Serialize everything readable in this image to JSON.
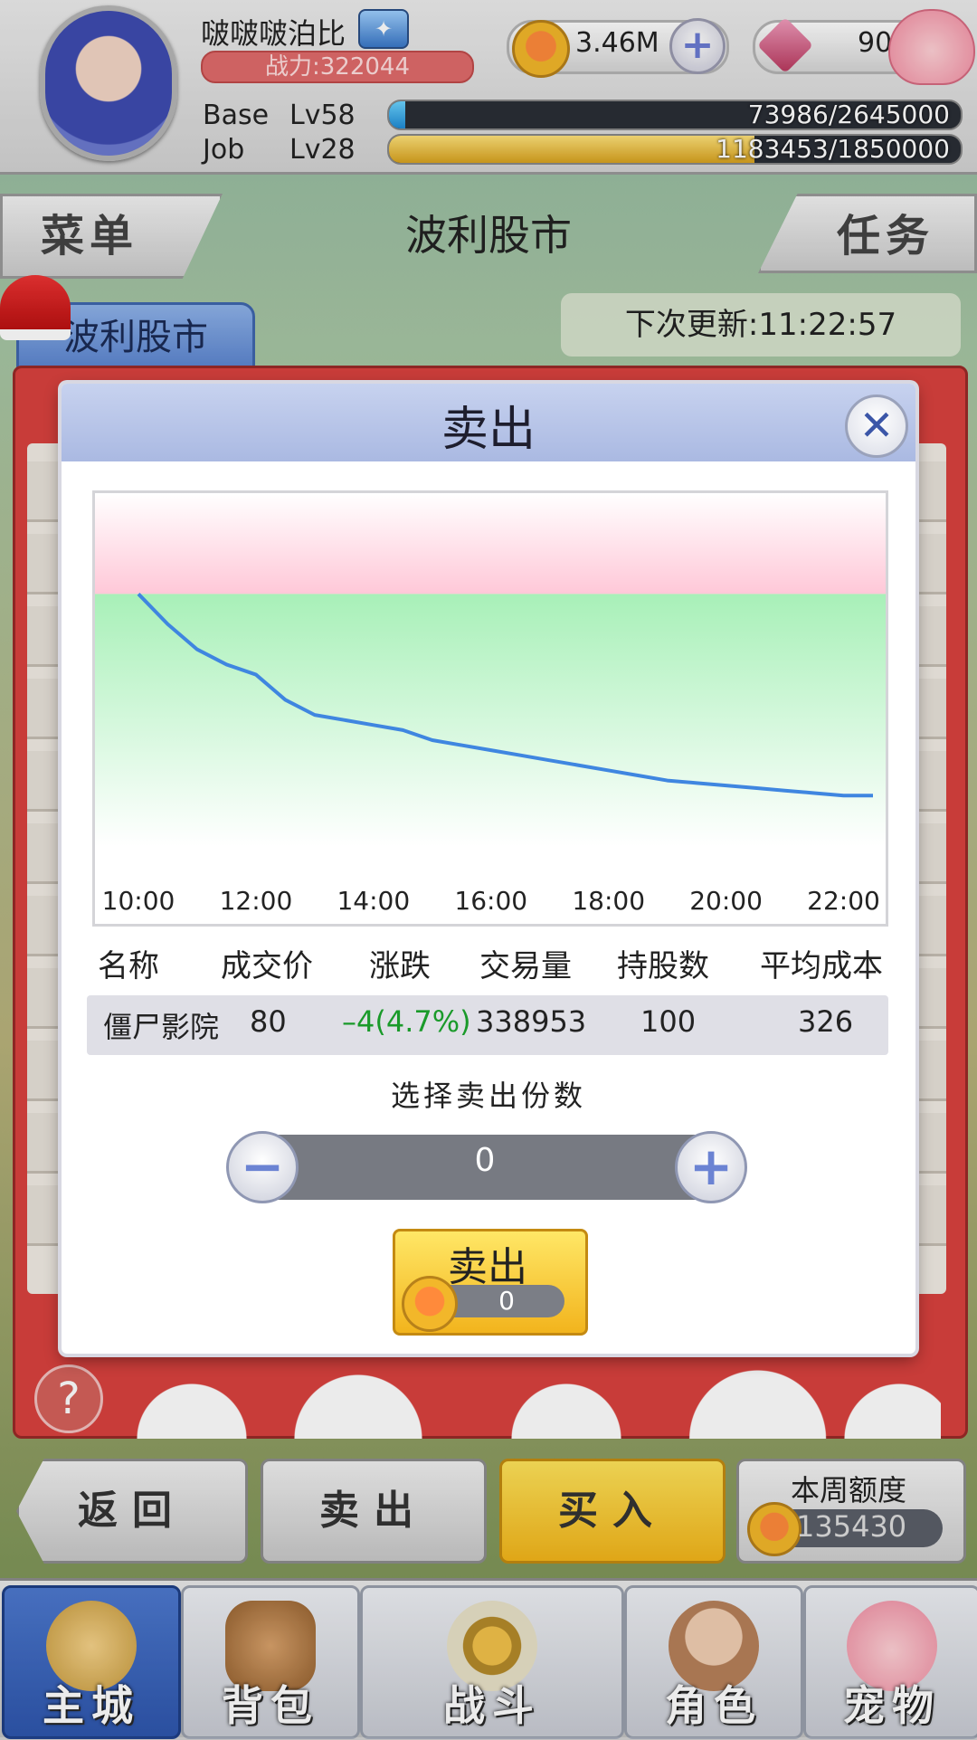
{
  "player": {
    "name": "啵啵啵泊比",
    "power": "战力:322044",
    "gold": "3.46M",
    "gems": "90",
    "base_label": "Base",
    "base_level": "Lv58",
    "base_exp": "73986/2645000",
    "base_progress": 0.028,
    "job_label": "Job",
    "job_level": "Lv28",
    "job_exp": "1183453/1850000",
    "job_progress": 0.64
  },
  "header": {
    "menu": "菜单",
    "title": "波利股市",
    "task": "任务"
  },
  "market": {
    "tab": "波利股市",
    "next_update": "下次更新:11:22:57"
  },
  "sell_dialog": {
    "title": "卖出",
    "columns": [
      "名称",
      "成交价",
      "涨跌",
      "交易量",
      "持股数",
      "平均成本"
    ],
    "row": {
      "name": "僵尸影院",
      "price": "80",
      "change": "–4(4.7%)",
      "volume": "338953",
      "holdings": "100",
      "avg_cost": "326"
    },
    "quantity_label": "选择卖出份数",
    "quantity": "0",
    "confirm_label": "卖出",
    "confirm_amount": "0"
  },
  "chart_data": {
    "type": "line",
    "x_ticks": [
      "10:00",
      "12:00",
      "14:00",
      "16:00",
      "18:00",
      "20:00",
      "22:00"
    ],
    "x": [
      "10:00",
      "10:30",
      "11:00",
      "11:30",
      "12:00",
      "12:30",
      "13:00",
      "13:30",
      "14:00",
      "14:30",
      "15:00",
      "15:30",
      "16:00",
      "16:30",
      "17:00",
      "17:30",
      "18:00",
      "18:30",
      "19:00",
      "19:30",
      "20:00",
      "20:30",
      "21:00",
      "21:30",
      "22:00",
      "22:30"
    ],
    "values": [
      84.0,
      83.4,
      82.9,
      82.6,
      82.4,
      81.9,
      81.6,
      81.5,
      81.4,
      81.3,
      81.1,
      81.0,
      80.9,
      80.8,
      80.7,
      80.6,
      80.5,
      80.4,
      80.3,
      80.25,
      80.2,
      80.15,
      80.1,
      80.05,
      80.0,
      80.0
    ],
    "reference_value": 84.0,
    "ylim": [
      79.0,
      86.0
    ],
    "line_color": "#3f86e0",
    "above_band_color": "#ffc8d8",
    "below_band_color": "#a8f0b8"
  },
  "actions": {
    "back": "返回",
    "sell": "卖出",
    "buy": "买入",
    "quota_label": "本周额度",
    "quota_value": "135430"
  },
  "nav": {
    "home": "主城",
    "bag": "背包",
    "battle": "战斗",
    "role": "角色",
    "pet": "宠物"
  },
  "colors": {
    "accent_red": "#d9423e",
    "modal_header": "#aab9e2",
    "buy_yellow": "#f3b51a",
    "nav_active": "#2e56ad"
  }
}
